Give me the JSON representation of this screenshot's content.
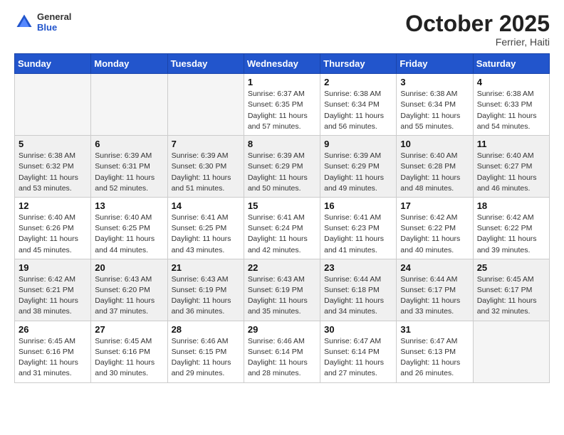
{
  "header": {
    "logo_general": "General",
    "logo_blue": "Blue",
    "month_title": "October 2025",
    "location": "Ferrier, Haiti"
  },
  "weekdays": [
    "Sunday",
    "Monday",
    "Tuesday",
    "Wednesday",
    "Thursday",
    "Friday",
    "Saturday"
  ],
  "weeks": [
    [
      {
        "day": "",
        "info": ""
      },
      {
        "day": "",
        "info": ""
      },
      {
        "day": "",
        "info": ""
      },
      {
        "day": "1",
        "info": "Sunrise: 6:37 AM\nSunset: 6:35 PM\nDaylight: 11 hours\nand 57 minutes."
      },
      {
        "day": "2",
        "info": "Sunrise: 6:38 AM\nSunset: 6:34 PM\nDaylight: 11 hours\nand 56 minutes."
      },
      {
        "day": "3",
        "info": "Sunrise: 6:38 AM\nSunset: 6:34 PM\nDaylight: 11 hours\nand 55 minutes."
      },
      {
        "day": "4",
        "info": "Sunrise: 6:38 AM\nSunset: 6:33 PM\nDaylight: 11 hours\nand 54 minutes."
      }
    ],
    [
      {
        "day": "5",
        "info": "Sunrise: 6:38 AM\nSunset: 6:32 PM\nDaylight: 11 hours\nand 53 minutes."
      },
      {
        "day": "6",
        "info": "Sunrise: 6:39 AM\nSunset: 6:31 PM\nDaylight: 11 hours\nand 52 minutes."
      },
      {
        "day": "7",
        "info": "Sunrise: 6:39 AM\nSunset: 6:30 PM\nDaylight: 11 hours\nand 51 minutes."
      },
      {
        "day": "8",
        "info": "Sunrise: 6:39 AM\nSunset: 6:29 PM\nDaylight: 11 hours\nand 50 minutes."
      },
      {
        "day": "9",
        "info": "Sunrise: 6:39 AM\nSunset: 6:29 PM\nDaylight: 11 hours\nand 49 minutes."
      },
      {
        "day": "10",
        "info": "Sunrise: 6:40 AM\nSunset: 6:28 PM\nDaylight: 11 hours\nand 48 minutes."
      },
      {
        "day": "11",
        "info": "Sunrise: 6:40 AM\nSunset: 6:27 PM\nDaylight: 11 hours\nand 46 minutes."
      }
    ],
    [
      {
        "day": "12",
        "info": "Sunrise: 6:40 AM\nSunset: 6:26 PM\nDaylight: 11 hours\nand 45 minutes."
      },
      {
        "day": "13",
        "info": "Sunrise: 6:40 AM\nSunset: 6:25 PM\nDaylight: 11 hours\nand 44 minutes."
      },
      {
        "day": "14",
        "info": "Sunrise: 6:41 AM\nSunset: 6:25 PM\nDaylight: 11 hours\nand 43 minutes."
      },
      {
        "day": "15",
        "info": "Sunrise: 6:41 AM\nSunset: 6:24 PM\nDaylight: 11 hours\nand 42 minutes."
      },
      {
        "day": "16",
        "info": "Sunrise: 6:41 AM\nSunset: 6:23 PM\nDaylight: 11 hours\nand 41 minutes."
      },
      {
        "day": "17",
        "info": "Sunrise: 6:42 AM\nSunset: 6:22 PM\nDaylight: 11 hours\nand 40 minutes."
      },
      {
        "day": "18",
        "info": "Sunrise: 6:42 AM\nSunset: 6:22 PM\nDaylight: 11 hours\nand 39 minutes."
      }
    ],
    [
      {
        "day": "19",
        "info": "Sunrise: 6:42 AM\nSunset: 6:21 PM\nDaylight: 11 hours\nand 38 minutes."
      },
      {
        "day": "20",
        "info": "Sunrise: 6:43 AM\nSunset: 6:20 PM\nDaylight: 11 hours\nand 37 minutes."
      },
      {
        "day": "21",
        "info": "Sunrise: 6:43 AM\nSunset: 6:19 PM\nDaylight: 11 hours\nand 36 minutes."
      },
      {
        "day": "22",
        "info": "Sunrise: 6:43 AM\nSunset: 6:19 PM\nDaylight: 11 hours\nand 35 minutes."
      },
      {
        "day": "23",
        "info": "Sunrise: 6:44 AM\nSunset: 6:18 PM\nDaylight: 11 hours\nand 34 minutes."
      },
      {
        "day": "24",
        "info": "Sunrise: 6:44 AM\nSunset: 6:17 PM\nDaylight: 11 hours\nand 33 minutes."
      },
      {
        "day": "25",
        "info": "Sunrise: 6:45 AM\nSunset: 6:17 PM\nDaylight: 11 hours\nand 32 minutes."
      }
    ],
    [
      {
        "day": "26",
        "info": "Sunrise: 6:45 AM\nSunset: 6:16 PM\nDaylight: 11 hours\nand 31 minutes."
      },
      {
        "day": "27",
        "info": "Sunrise: 6:45 AM\nSunset: 6:16 PM\nDaylight: 11 hours\nand 30 minutes."
      },
      {
        "day": "28",
        "info": "Sunrise: 6:46 AM\nSunset: 6:15 PM\nDaylight: 11 hours\nand 29 minutes."
      },
      {
        "day": "29",
        "info": "Sunrise: 6:46 AM\nSunset: 6:14 PM\nDaylight: 11 hours\nand 28 minutes."
      },
      {
        "day": "30",
        "info": "Sunrise: 6:47 AM\nSunset: 6:14 PM\nDaylight: 11 hours\nand 27 minutes."
      },
      {
        "day": "31",
        "info": "Sunrise: 6:47 AM\nSunset: 6:13 PM\nDaylight: 11 hours\nand 26 minutes."
      },
      {
        "day": "",
        "info": ""
      }
    ]
  ]
}
